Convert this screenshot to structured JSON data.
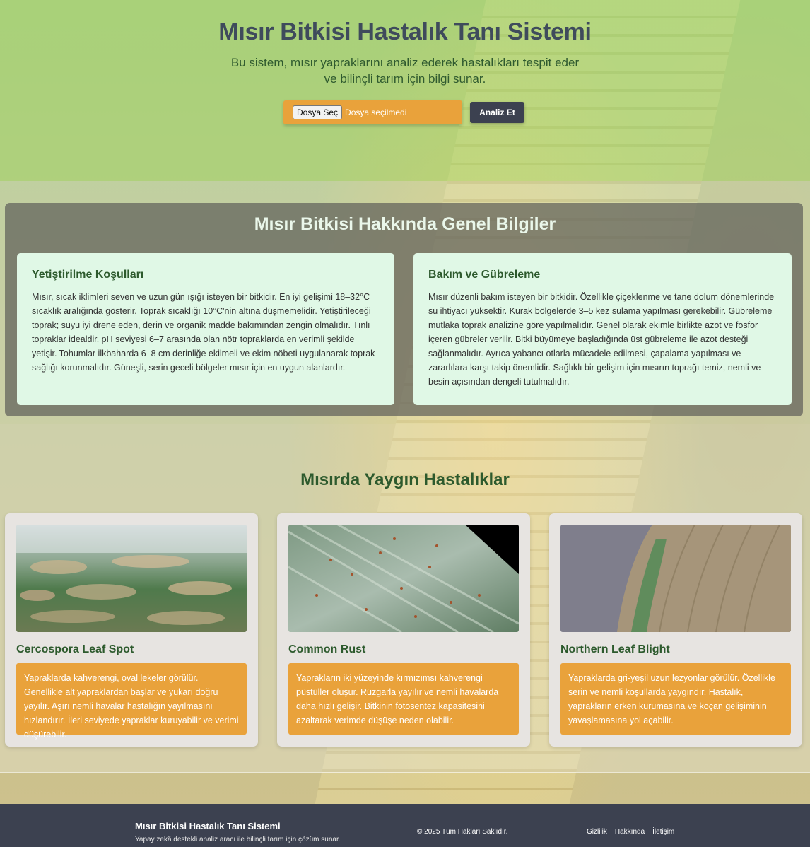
{
  "header": {
    "title": "Mısır Bitkisi Hastalık Tanı Sistemi",
    "subtitle": "Bu sistem, mısır yapraklarını analiz ederek hastalıkları tespit eder ve bilinçli tarım için bilgi sunar.",
    "file_button": "Dosya Seç",
    "file_status": "Dosya seçilmedi",
    "analyze_button": "Analiz Et"
  },
  "info": {
    "title": "Mısır Bitkisi Hakkında Genel Bilgiler",
    "cards": [
      {
        "title": "Yetiştirilme Koşulları",
        "text": "Mısır, sıcak iklimleri seven ve uzun gün ışığı isteyen bir bitkidir. En iyi gelişimi 18–32°C sıcaklık aralığında gösterir. Toprak sıcaklığı 10°C'nin altına düşmemelidir. Yetiştirileceği toprak; suyu iyi drene eden, derin ve organik madde bakımından zengin olmalıdır. Tınlı topraklar idealdir. pH seviyesi 6–7 arasında olan nötr topraklarda en verimli şekilde yetişir. Tohumlar ilkbaharda 6–8 cm derinliğe ekilmeli ve ekim nöbeti uygulanarak toprak sağlığı korunmalıdır. Güneşli, serin geceli bölgeler mısır için en uygun alanlardır."
      },
      {
        "title": "Bakım ve Gübreleme",
        "text": "Mısır düzenli bakım isteyen bir bitkidir. Özellikle çiçeklenme ve tane dolum dönemlerinde su ihtiyacı yüksektir. Kurak bölgelerde 3–5 kez sulama yapılması gerekebilir. Gübreleme mutlaka toprak analizine göre yapılmalıdır. Genel olarak ekimle birlikte azot ve fosfor içeren gübreler verilir. Bitki büyümeye başladığında üst gübreleme ile azot desteği sağlanmalıdır. Ayrıca yabancı otlarla mücadele edilmesi, çapalama yapılması ve zararlılara karşı takip önemlidir. Sağlıklı bir gelişim için mısırın toprağı temiz, nemli ve besin açısından dengeli tutulmalıdır."
      }
    ]
  },
  "diseases": {
    "title": "Mısırda Yaygın Hastalıklar",
    "items": [
      {
        "name": "Cercospora Leaf Spot",
        "description": "Yapraklarda kahverengi, oval lekeler görülür. Genellikle alt yapraklardan başlar ve yukarı doğru yayılır. Aşırı nemli havalar hastalığın yayılmasını hızlandırır. İleri seviyede yapraklar kuruyabilir ve verimi düşürebilir."
      },
      {
        "name": "Common Rust",
        "description": "Yaprakların iki yüzeyinde kırmızımsı kahverengi püstüller oluşur. Rüzgarla yayılır ve nemli havalarda daha hızlı gelişir. Bitkinin fotosentez kapasitesini azaltarak verimde düşüşe neden olabilir."
      },
      {
        "name": "Northern Leaf Blight",
        "description": "Yapraklarda gri-yeşil uzun lezyonlar görülür. Özellikle serin ve nemli koşullarda yaygındır. Hastalık, yaprakların erken kurumasına ve koçan gelişiminin yavaşlamasına yol açabilir."
      }
    ]
  },
  "footer": {
    "title": "Mısır Bitkisi Hastalık Tanı Sistemi",
    "subtitle": "Yapay zekâ destekli analiz aracı ile bilinçli tarım için çözüm sunar.",
    "copyright": "© 2025 Tüm Hakları Saklıdır.",
    "links": [
      "Gizlilik",
      "Hakkında",
      "İletişim"
    ]
  }
}
